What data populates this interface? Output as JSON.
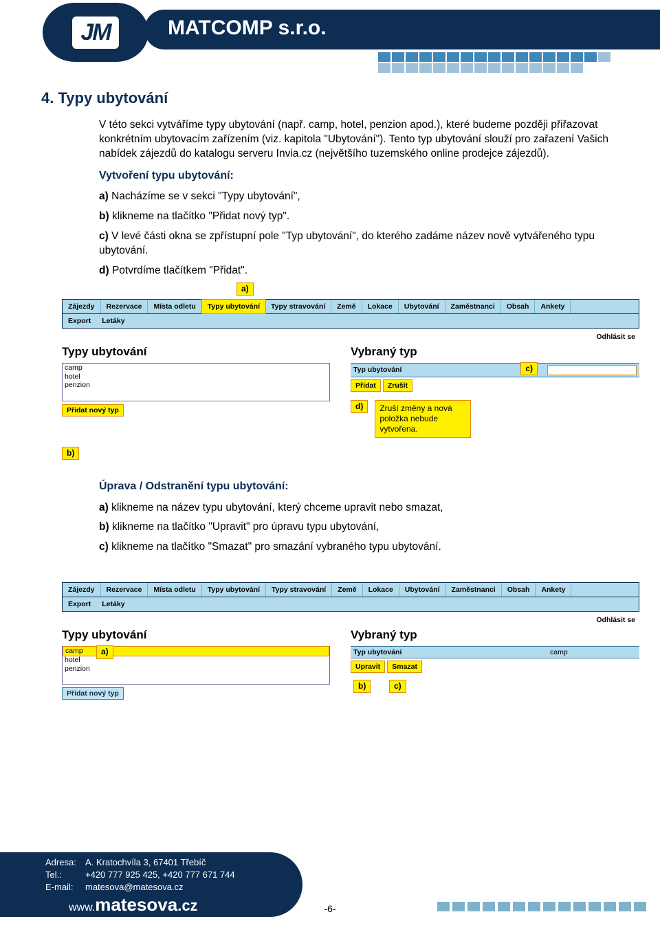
{
  "header": {
    "logo_text": "JM",
    "company": "MATCOMP s.r.o."
  },
  "section": {
    "title": "4. Typy ubytování",
    "intro_p1": "V této sekci vytváříme typy ubytování (např. camp, hotel, penzion apod.), které budeme později přiřazovat konkrétním ubytovacím zařízením (viz. kapitola \"Ubytování\"). Tento typ ubytování slouží pro zařazení Vašich nabídek zájezdů do katalogu serveru Invia.cz (největšího tuzemského online prodejce zájezdů).",
    "create_h": "Vytvoření typu ubytování:",
    "create_a": "Nacházíme se v sekci \"Typy ubytování\",",
    "create_b": "klikneme na tlačítko \"Přidat nový typ\".",
    "create_c": "V levé části okna se zpřístupní pole \"Typ ubytování\", do kterého zadáme název nově vytvářeného typu ubytování.",
    "create_d": "Potvrdíme tlačítkem \"Přidat\".",
    "edit_h": "Úprava / Odstranění typu ubytování:",
    "edit_a": "klikneme na název typu ubytování, který chceme upravit nebo smazat,",
    "edit_b": "klikneme na tlačítko \"Upravit\" pro úpravu typu ubytování,",
    "edit_c": "klikneme na tlačítko \"Smazat\" pro smazání vybraného typu ubytování."
  },
  "shot1": {
    "tabs": [
      "Zájezdy",
      "Rezervace",
      "Místa odletu",
      "Typy ubytování",
      "Typy stravování",
      "Země",
      "Lokace",
      "Ubytování",
      "Zaměstnanci",
      "Obsah",
      "Ankety"
    ],
    "tabs2": [
      "Export",
      "Letáky"
    ],
    "logout": "Odhlásit se",
    "left_title": "Typy ubytování",
    "list": [
      "camp",
      "hotel",
      "penzion"
    ],
    "add_btn": "Přidat nový typ",
    "right_title": "Vybraný typ",
    "field_label": "Typ ubytování",
    "field_value": "",
    "btn_add": "Přidat",
    "btn_cancel": "Zrušit",
    "note": "Zruší změny a nová položka nebude vytvořena.",
    "call_a": "a)",
    "call_b": "b)",
    "call_c": "c)",
    "call_d": "d)"
  },
  "shot2": {
    "tabs": [
      "Zájezdy",
      "Rezervace",
      "Místa odletu",
      "Typy ubytování",
      "Typy stravování",
      "Země",
      "Lokace",
      "Ubytování",
      "Zaměstnanci",
      "Obsah",
      "Ankety"
    ],
    "tabs2": [
      "Export",
      "Letáky"
    ],
    "logout": "Odhlásit se",
    "left_title": "Typy ubytování",
    "list": [
      "camp",
      "hotel",
      "penzion"
    ],
    "add_btn": "Přidat nový typ",
    "right_title": "Vybraný typ",
    "field_label": "Typ ubytování",
    "field_value": "camp",
    "btn_edit": "Upravit",
    "btn_delete": "Smazat",
    "call_a": "a)",
    "call_b": "b)",
    "call_c": "c)"
  },
  "footer": {
    "addr_lbl": "Adresa:",
    "addr": "A. Kratochvíla 3, 67401 Třebíč",
    "tel_lbl": "Tel.:",
    "tel": "+420 777 925 425, +420 777 671 744",
    "mail_lbl": "E-mail:",
    "mail": "matesova@matesova.cz",
    "url_www": "www.",
    "url_main": "matesova",
    "url_tld": ".cz",
    "page": "-6-"
  }
}
